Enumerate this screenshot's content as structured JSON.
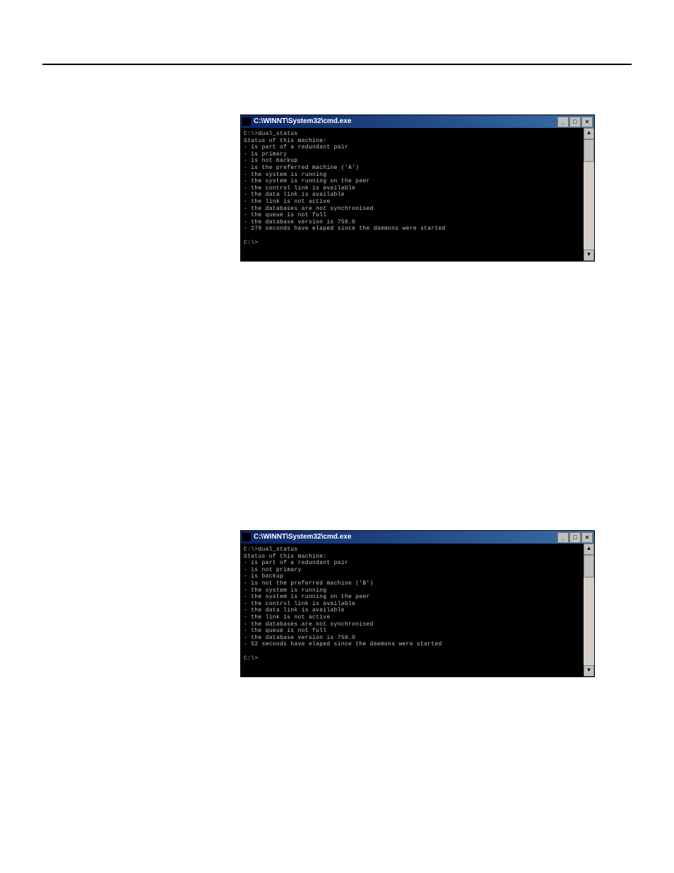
{
  "window1": {
    "title": "C:\\WINNT\\System32\\cmd.exe",
    "prompt1": "C:\\>dual_status",
    "header": "Status of this machine:",
    "lines": [
      "- is part of a redundant pair",
      "- is primary",
      "- is not backup",
      "- is the preferred machine ('A')",
      "- the system is running",
      "- the system is running on the peer",
      "- the control link is available",
      "- the data link is available",
      "- the link is not active",
      "- the databases are not synchronised",
      "- the queue is not full",
      "- the database version is 750.0",
      "- 270 seconds have elaped since the daemons were started"
    ],
    "prompt2": "C:\\>"
  },
  "window2": {
    "title": "C:\\WINNT\\System32\\cmd.exe",
    "prompt1": "C:\\>dual_status",
    "header": "Status of this machine:",
    "lines": [
      "- is part of a redundant pair",
      "- is not primary",
      "- is backup",
      "- is not the preferred machine ('B')",
      "- the system is running",
      "- the system is running on the peer",
      "- the control link is available",
      "- the data link is available",
      "- the link is not active",
      "- the databases are not synchronised",
      "- the queue is not full",
      "- the database version is 750.0",
      "- 52 seconds have elaped since the daemons were started"
    ],
    "prompt2": "C:\\>"
  },
  "buttons": {
    "min": "_",
    "max": "□",
    "close": "×",
    "up": "▲",
    "down": "▼"
  }
}
